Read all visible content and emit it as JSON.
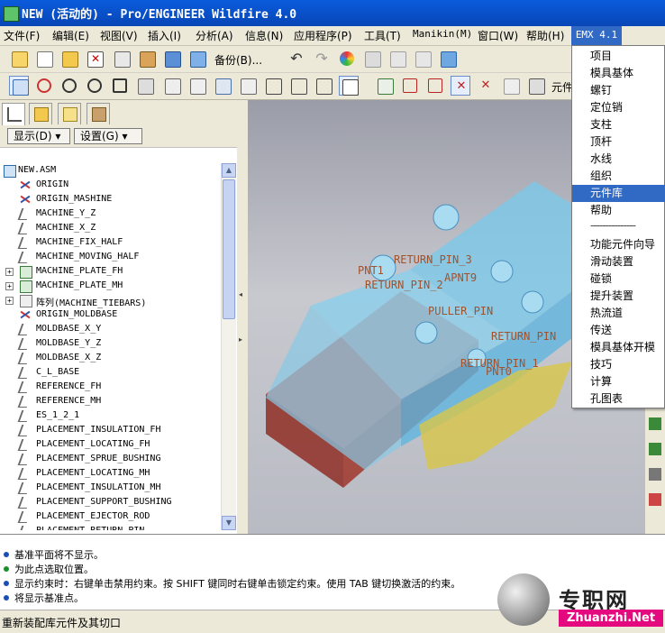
{
  "window": {
    "title": "NEW (活动的) - Pro/ENGINEER Wildfire 4.0",
    "icon": "proe-app-icon"
  },
  "menubar": {
    "items": [
      "文件(F)",
      "编辑(E)",
      "视图(V)",
      "插入(I)",
      "分析(A)",
      "信息(N)",
      "应用程序(P)",
      "工具(T)",
      "Manikin(M)",
      "窗口(W)",
      "帮助(H)"
    ],
    "active": "EMX 4.1"
  },
  "toolbar": {
    "backup_label": "备份(B)...",
    "component_label": "元件"
  },
  "navigator": {
    "show_button": "显示(D) ▾",
    "settings_button": "设置(G) ▾",
    "tree": [
      {
        "label": "NEW.ASM",
        "icon": "assembly-icon",
        "expand": ""
      },
      {
        "label": "ORIGIN",
        "icon": "csys-icon",
        "expand": ""
      },
      {
        "label": "ORIGIN_MASHINE",
        "icon": "csys-icon",
        "expand": ""
      },
      {
        "label": "MACHINE_Y_Z",
        "icon": "datum-plane-icon",
        "expand": ""
      },
      {
        "label": "MACHINE_X_Z",
        "icon": "datum-plane-icon",
        "expand": ""
      },
      {
        "label": "MACHINE_FIX_HALF",
        "icon": "datum-plane-icon",
        "expand": ""
      },
      {
        "label": "MACHINE_MOVING_HALF",
        "icon": "datum-plane-icon",
        "expand": ""
      },
      {
        "label": "MACHINE_PLATE_FH",
        "icon": "part-icon",
        "expand": "+"
      },
      {
        "label": "MACHINE_PLATE_MH",
        "icon": "part-icon",
        "expand": "+"
      },
      {
        "label": "阵列(MACHINE_TIEBARS)",
        "icon": "pattern-icon",
        "expand": "+"
      },
      {
        "label": "ORIGIN_MOLDBASE",
        "icon": "csys-icon",
        "expand": ""
      },
      {
        "label": "MOLDBASE_X_Y",
        "icon": "datum-plane-icon",
        "expand": ""
      },
      {
        "label": "MOLDBASE_Y_Z",
        "icon": "datum-plane-icon",
        "expand": ""
      },
      {
        "label": "MOLDBASE_X_Z",
        "icon": "datum-plane-icon",
        "expand": ""
      },
      {
        "label": "C_L_BASE",
        "icon": "datum-plane-icon",
        "expand": ""
      },
      {
        "label": "REFERENCE_FH",
        "icon": "datum-plane-icon",
        "expand": ""
      },
      {
        "label": "REFERENCE_MH",
        "icon": "datum-plane-icon",
        "expand": ""
      },
      {
        "label": "ES_1_2_1",
        "icon": "datum-plane-icon",
        "expand": ""
      },
      {
        "label": "PLACEMENT_INSULATION_FH",
        "icon": "datum-plane-icon",
        "expand": ""
      },
      {
        "label": "PLACEMENT_LOCATING_FH",
        "icon": "datum-plane-icon",
        "expand": ""
      },
      {
        "label": "PLACEMENT_SPRUE_BUSHING",
        "icon": "datum-plane-icon",
        "expand": ""
      },
      {
        "label": "PLACEMENT_LOCATING_MH",
        "icon": "datum-plane-icon",
        "expand": ""
      },
      {
        "label": "PLACEMENT_INSULATION_MH",
        "icon": "datum-plane-icon",
        "expand": ""
      },
      {
        "label": "PLACEMENT_SUPPORT_BUSHING",
        "icon": "datum-plane-icon",
        "expand": ""
      },
      {
        "label": "PLACEMENT_EJECTOR_ROD",
        "icon": "datum-plane-icon",
        "expand": ""
      },
      {
        "label": "PLACEMENT_RETURN_PIN",
        "icon": "datum-plane-icon",
        "expand": ""
      }
    ]
  },
  "viewport": {
    "labels": [
      "RETURN_PIN_3",
      "PNT1",
      "APNT9",
      "RETURN_PIN_2",
      "PULLER_PIN",
      "RETURN_PIN",
      "RETURN_PIN_1",
      "PNT0"
    ]
  },
  "emx_menu": {
    "items": [
      "项目",
      "模具基体",
      "螺钉",
      "定位销",
      "支柱",
      "顶杆",
      "水线",
      "组织",
      "元件库",
      "帮助",
      "---------------",
      "功能元件向导",
      "滑动装置",
      "碰锁",
      "提升装置",
      "热流道",
      "传送",
      "模具基体开模",
      "技巧",
      "计算",
      "孔图表"
    ],
    "highlighted": "元件库"
  },
  "messages": [
    {
      "text": "基准平面将不显示。",
      "color": "blue"
    },
    {
      "text": "为此点选取位置。",
      "color": "green"
    },
    {
      "text": "显示约束时：右键单击禁用约束。按 SHIFT 键同时右键单击锁定约束。使用 TAB 键切换激活的约束。",
      "color": "blue"
    },
    {
      "text": "将显示基准点。",
      "color": "blue"
    }
  ],
  "status": {
    "text": "重新装配库元件及其切口"
  },
  "watermark": {
    "brand": "专职网",
    "url": "Zhuanzhi.Net"
  }
}
